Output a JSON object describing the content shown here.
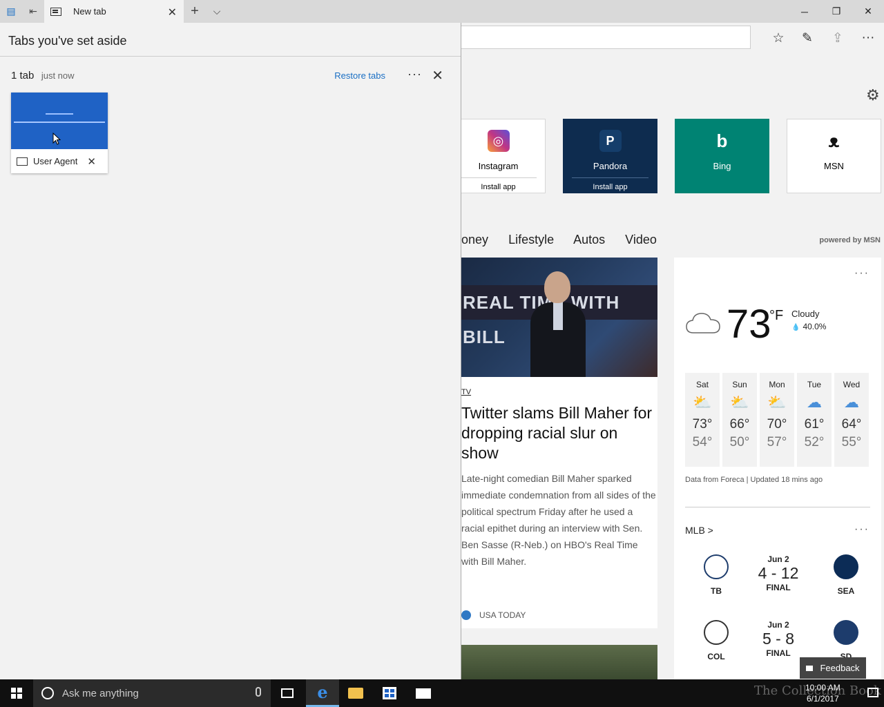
{
  "browser": {
    "active_tab_title": "New tab",
    "window_controls": {
      "minimize": "─",
      "restore": "❐",
      "close": "✕"
    }
  },
  "toolbar": {
    "favorites_icon": "☆",
    "notes_icon": "✎",
    "share_icon": "⇪",
    "more_icon": "···"
  },
  "newtab": {
    "settings_icon": "⚙",
    "tiles": [
      {
        "name": "Instagram",
        "sub": "Install app",
        "color": "#c13584"
      },
      {
        "name": "Pandora",
        "sub": "Install app",
        "color": "#0e2c4f"
      },
      {
        "name": "Bing",
        "sub": "",
        "color": "#008373"
      },
      {
        "name": "MSN",
        "sub": "",
        "color": "#ffffff"
      }
    ],
    "categories": [
      "oney",
      "Lifestyle",
      "Autos",
      "Video"
    ],
    "powered_by": "powered by MSN",
    "article": {
      "banner_text": "REAL TIME WITH BILL",
      "category": "TV",
      "title": "Twitter slams Bill Maher for dropping racial slur on show",
      "description": "Late-night comedian Bill Maher sparked immediate condemnation from all sides of the political spectrum Friday after he used a racial epithet during an interview with Sen. Ben Sasse (R-Neb.) on HBO's Real Time with Bill Maher.",
      "source": "USA TODAY"
    },
    "weather": {
      "more": "···",
      "temp": "73",
      "unit": "°F",
      "condition": "Cloudy",
      "precip": "40.0%",
      "forecast": [
        {
          "day": "Sat",
          "hi": "73°",
          "lo": "54°"
        },
        {
          "day": "Sun",
          "hi": "66°",
          "lo": "50°"
        },
        {
          "day": "Mon",
          "hi": "70°",
          "lo": "57°"
        },
        {
          "day": "Tue",
          "hi": "61°",
          "lo": "52°"
        },
        {
          "day": "Wed",
          "hi": "64°",
          "lo": "55°"
        }
      ],
      "data_source": "Data from Foreca | Updated 18 mins ago"
    },
    "mlb": {
      "title": "MLB >",
      "more": "···",
      "games": [
        {
          "home": "TB",
          "away": "SEA",
          "date": "Jun 2",
          "score": "4 - 12",
          "status": "FINAL"
        },
        {
          "home": "COL",
          "away": "SD",
          "date": "Jun 2",
          "score": "5 - 8",
          "status": "FINAL"
        }
      ]
    },
    "feedback": "Feedback"
  },
  "aside_panel": {
    "header": "Tabs you've set aside",
    "group_count": "1 tab",
    "group_time": "just now",
    "restore_label": "Restore tabs",
    "more": "···",
    "close": "✕",
    "card_title": "User Agent"
  },
  "taskbar": {
    "search_placeholder": "Ask me anything",
    "time": "10:00 AM",
    "date": "6/1/2017",
    "watermark": "The Collection Book"
  }
}
